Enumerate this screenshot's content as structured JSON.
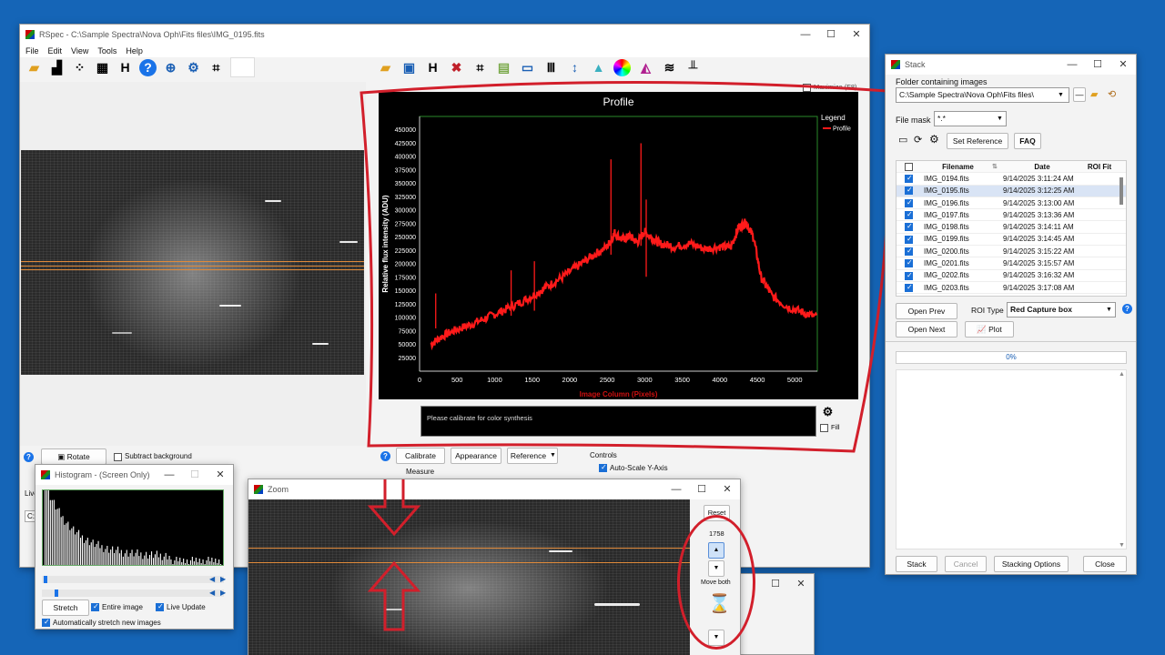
{
  "main": {
    "title": "RSpec - C:\\Sample Spectra\\Nova Oph\\Fits files\\IMG_0195.fits",
    "menu": [
      "File",
      "Edit",
      "View",
      "Tools",
      "Help"
    ],
    "maximize_label": "Maximize (F8)",
    "rotate_label": "Rotate",
    "subtract_bg_label": "Subtract background",
    "tabs": [
      "Calibrate",
      "Appearance",
      "Reference"
    ],
    "controls_label": "Controls",
    "autoscale_label": "Auto-Scale Y-Axis",
    "measure_label": "Measure",
    "live_label": "Live",
    "c_label": "C:\\",
    "message": "Please calibrate for color synthesis",
    "fill_label": "Fill"
  },
  "chart_data": {
    "type": "line",
    "title": "Profile",
    "xlabel": "Image Column (Pixels)",
    "ylabel": "Relative flux intensity (ADU)",
    "xlim": [
      0,
      5300
    ],
    "ylim": [
      0,
      475000
    ],
    "xticks": [
      0,
      500,
      1000,
      1500,
      2000,
      2500,
      3000,
      3500,
      4000,
      4500,
      5000
    ],
    "yticks": [
      25000,
      50000,
      75000,
      100000,
      125000,
      150000,
      175000,
      200000,
      225000,
      250000,
      275000,
      300000,
      325000,
      350000,
      375000,
      400000,
      425000,
      450000
    ],
    "legend_title": "Legend",
    "series": [
      {
        "name": "Profile",
        "color": "#ff1a1a",
        "x": [
          150,
          300,
          500,
          700,
          900,
          1100,
          1300,
          1500,
          1700,
          1900,
          2100,
          2300,
          2500,
          2600,
          2700,
          2800,
          2900,
          3000,
          3100,
          3200,
          3400,
          3600,
          3800,
          4000,
          4150,
          4250,
          4350,
          4450,
          4550,
          4700,
          4900,
          5100,
          5300
        ],
        "y": [
          50000,
          65000,
          78000,
          88000,
          100000,
          112000,
          125000,
          140000,
          158000,
          175000,
          195000,
          215000,
          232000,
          258000,
          245000,
          252000,
          240000,
          260000,
          248000,
          238000,
          232000,
          238000,
          228000,
          232000,
          232000,
          268000,
          278000,
          250000,
          175000,
          140000,
          120000,
          110000,
          100000
        ]
      }
    ],
    "spikes": [
      {
        "x": 215,
        "y": 145000
      },
      {
        "x": 1220,
        "y": 188000
      },
      {
        "x": 1530,
        "y": 205000
      },
      {
        "x": 2550,
        "y": 395000
      },
      {
        "x": 2950,
        "y": 425000
      },
      {
        "x": 3020,
        "y": 320000
      }
    ],
    "legend_placement": "top-right",
    "background": "#000000",
    "grid": false
  },
  "histogram": {
    "title": "Histogram - (Screen Only)",
    "stretch_label": "Stretch",
    "entire_label": "Entire image",
    "live_label": "Live Update",
    "auto_label": "Automatically stretch new images"
  },
  "zoom": {
    "title": "Zoom",
    "reset_label": "Reset",
    "value": "1758",
    "move_both_label": "Move both"
  },
  "stack": {
    "title": "Stack",
    "folder_label": "Folder containing images",
    "folder_value": "C:\\Sample Spectra\\Nova Oph\\Fits files\\",
    "mask_label": "File mask",
    "mask_value": "*.*",
    "set_ref_label": "Set Reference",
    "faq_label": "FAQ",
    "columns": [
      "Filename",
      "Date",
      "ROI Fit"
    ],
    "rows": [
      {
        "file": "IMG_0194.fits",
        "date": "9/14/2025 3:11:24 AM"
      },
      {
        "file": "IMG_0195.fits",
        "date": "9/14/2025 3:12:25 AM"
      },
      {
        "file": "IMG_0196.fits",
        "date": "9/14/2025 3:13:00 AM"
      },
      {
        "file": "IMG_0197.fits",
        "date": "9/14/2025 3:13:36 AM"
      },
      {
        "file": "IMG_0198.fits",
        "date": "9/14/2025 3:14:11 AM"
      },
      {
        "file": "IMG_0199.fits",
        "date": "9/14/2025 3:14:45 AM"
      },
      {
        "file": "IMG_0200.fits",
        "date": "9/14/2025 3:15:22 AM"
      },
      {
        "file": "IMG_0201.fits",
        "date": "9/14/2025 3:15:57 AM"
      },
      {
        "file": "IMG_0202.fits",
        "date": "9/14/2025 3:16:32 AM"
      },
      {
        "file": "IMG_0203.fits",
        "date": "9/14/2025 3:17:08 AM"
      }
    ],
    "open_prev_label": "Open Prev",
    "open_next_label": "Open Next",
    "roi_type_label": "ROI Type",
    "roi_type_value": "Red Capture box",
    "plot_label": "Plot",
    "progress": "0%",
    "progress_value": 0,
    "stack_label": "Stack",
    "cancel_label": "Cancel",
    "options_label": "Stacking Options",
    "close_label": "Close"
  }
}
